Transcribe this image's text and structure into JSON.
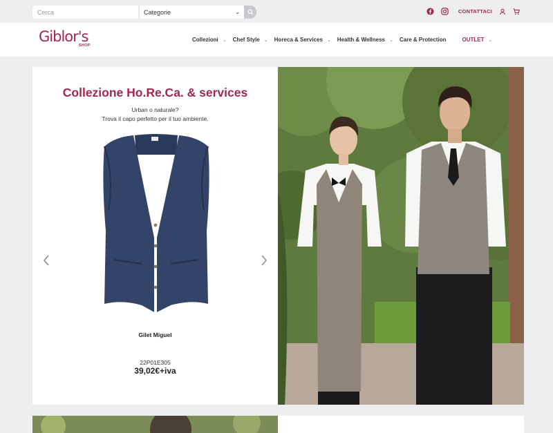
{
  "topbar": {
    "search_placeholder": "Cerca",
    "category_label": "Categorie",
    "contact_label": "CONTATTACI",
    "icons": [
      "search-icon",
      "facebook-icon",
      "instagram-icon",
      "user-icon",
      "cart-icon"
    ]
  },
  "header": {
    "logo_text": "Giblor's",
    "logo_sub": "SHOP",
    "nav": [
      {
        "label": "Collezioni"
      },
      {
        "label": "Chef Style"
      },
      {
        "label": "Horeca & Services"
      },
      {
        "label": "Health & Wellness"
      },
      {
        "label": "Care & Protection"
      },
      {
        "label": "OUTLET"
      }
    ]
  },
  "hero": {
    "title": "Collezione Ho.Re.Ca. & services",
    "subtitle_line1": "Urban o naturale?",
    "subtitle_line2": "Trova il capo perfetto per il tuo ambiente.",
    "product_name": "Gilet Miguel",
    "product_code": "22P01E305",
    "product_price": "39,02€+iva"
  },
  "colors": {
    "brand": "#a3284c",
    "page_bg": "#eeeef0"
  }
}
